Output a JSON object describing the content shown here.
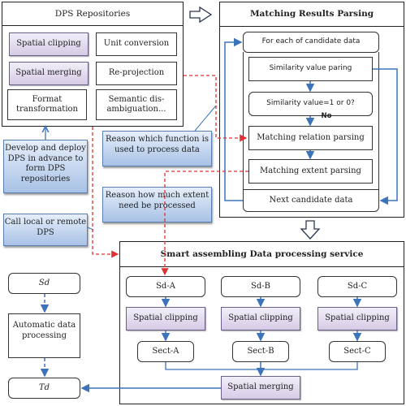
{
  "dps_repositories": {
    "title": "DPS Repositories",
    "items": [
      {
        "label": "Spatial clipping",
        "style": "highlighted"
      },
      {
        "label": "Unit conversion",
        "style": "plain"
      },
      {
        "label": "Spatial merging",
        "style": "highlighted"
      },
      {
        "label": "Re-projection",
        "style": "plain"
      },
      {
        "label": "Format transformation",
        "style": "plain"
      },
      {
        "label": "Semantic dis-ambiguation...",
        "style": "plain"
      }
    ]
  },
  "matching_results_parsing": {
    "title": "Matching Results Parsing",
    "loop_start": "For each of candidate data",
    "steps": [
      "Similarity value paring",
      "Similarity value=1 or 0?",
      "Matching relation parsing",
      "Matching extent parsing"
    ],
    "no_label": "No",
    "loop_end": "Next candidate data"
  },
  "annotations": {
    "develop_deploy": "Develop and deploy DPS in advance to form DPS repositories",
    "reason_function": "Reason which  function is used to process data",
    "reason_extent": "Reason how much  extent need be processed",
    "call_dps": "Call local or remote DPS"
  },
  "left_flow": {
    "source": "Sd",
    "process": "Automatic data processing",
    "target": "Td"
  },
  "smart_assembling": {
    "title": "Smart assembling Data processing service",
    "columns": [
      {
        "source": "Sd-A",
        "process": "Spatial clipping",
        "result": "Sect-A"
      },
      {
        "source": "Sd-B",
        "process": "Spatial clipping",
        "result": "Sect-B"
      },
      {
        "source": "Sd-C",
        "process": "Spatial clipping",
        "result": "Sect-C"
      }
    ],
    "merge": "Spatial merging"
  },
  "colors": {
    "connector_blue": "#3d73bb",
    "dashed_red": "#e03030",
    "purple_fill": "#d6cbe6",
    "blue_fill": "#a8c2e6"
  }
}
